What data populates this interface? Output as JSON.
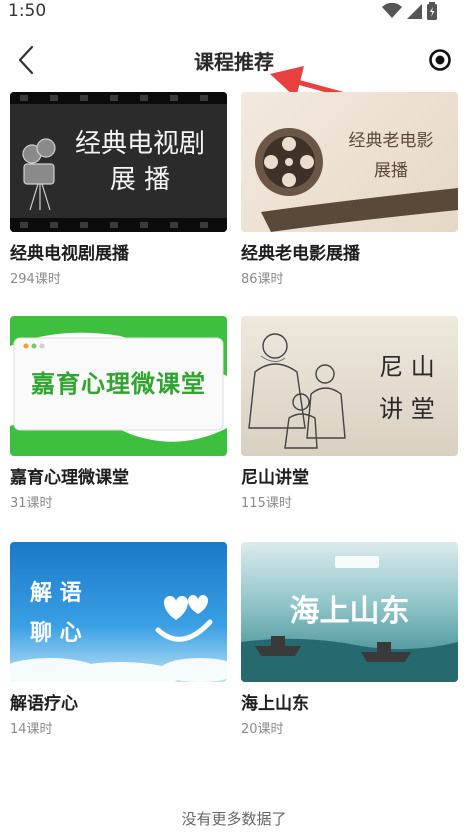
{
  "status_bar": {
    "time": "1:50"
  },
  "header": {
    "title": "课程推荐"
  },
  "courses": [
    {
      "title": "经典电视剧展播",
      "lessons": "294课时",
      "art_text": [
        "经典电视剧",
        "展  播"
      ]
    },
    {
      "title": "经典老电影展播",
      "lessons": "86课时",
      "art_text": [
        "经典老电影",
        "展播"
      ]
    },
    {
      "title": "嘉育心理微课堂",
      "lessons": "31课时",
      "art_text": [
        "嘉育心理微课堂"
      ]
    },
    {
      "title": "尼山讲堂",
      "lessons": "115课时",
      "art_text": [
        "尼  山",
        "讲  堂"
      ]
    },
    {
      "title": "解语疗心",
      "lessons": "14课时",
      "art_text": [
        "解  语",
        "聊  心"
      ]
    },
    {
      "title": "海上山东",
      "lessons": "20课时",
      "art_text": [
        "海上山东"
      ]
    }
  ],
  "footer": {
    "text": "没有更多数据了"
  },
  "colors": {
    "annotation_arrow": "#e8403f",
    "title": "#2a2a2a",
    "sub": "#8a8a8a",
    "green": "#3fbf3f"
  }
}
